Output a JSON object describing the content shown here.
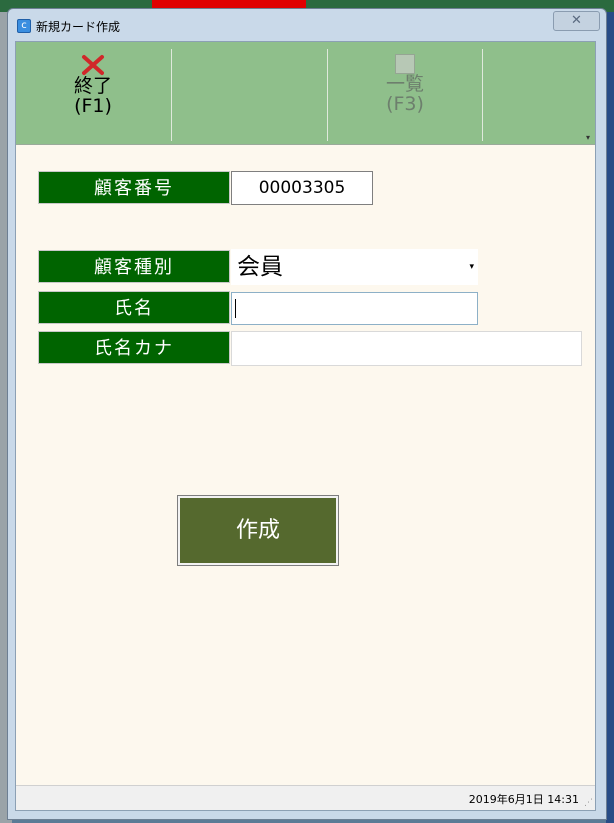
{
  "window": {
    "title": "新規カード作成",
    "close_label": "✕"
  },
  "toolbar": {
    "buttons": [
      {
        "label": "終了",
        "key": "(F1)",
        "icon": "close-x-icon",
        "enabled": true
      },
      {
        "label": "",
        "key": "",
        "icon": "",
        "enabled": true
      },
      {
        "label": "一覧",
        "key": "(F3)",
        "icon": "list-icon",
        "enabled": false
      },
      {
        "label": "",
        "key": "",
        "icon": "",
        "enabled": true
      }
    ]
  },
  "form": {
    "customer_number_label": "顧客番号",
    "customer_number_value": "00003305",
    "customer_type_label": "顧客種別",
    "customer_type_value": "会員",
    "name_label": "氏名",
    "name_value": "",
    "name_kana_label": "氏名カナ",
    "name_kana_value": ""
  },
  "create_button_label": "作成",
  "status": {
    "datetime": "2019年6月1日 14:31"
  },
  "colors": {
    "toolbar_bg": "#8fbf8b",
    "label_bg": "#006400",
    "create_bg": "#55692e",
    "client_bg": "#fdf8ee"
  }
}
